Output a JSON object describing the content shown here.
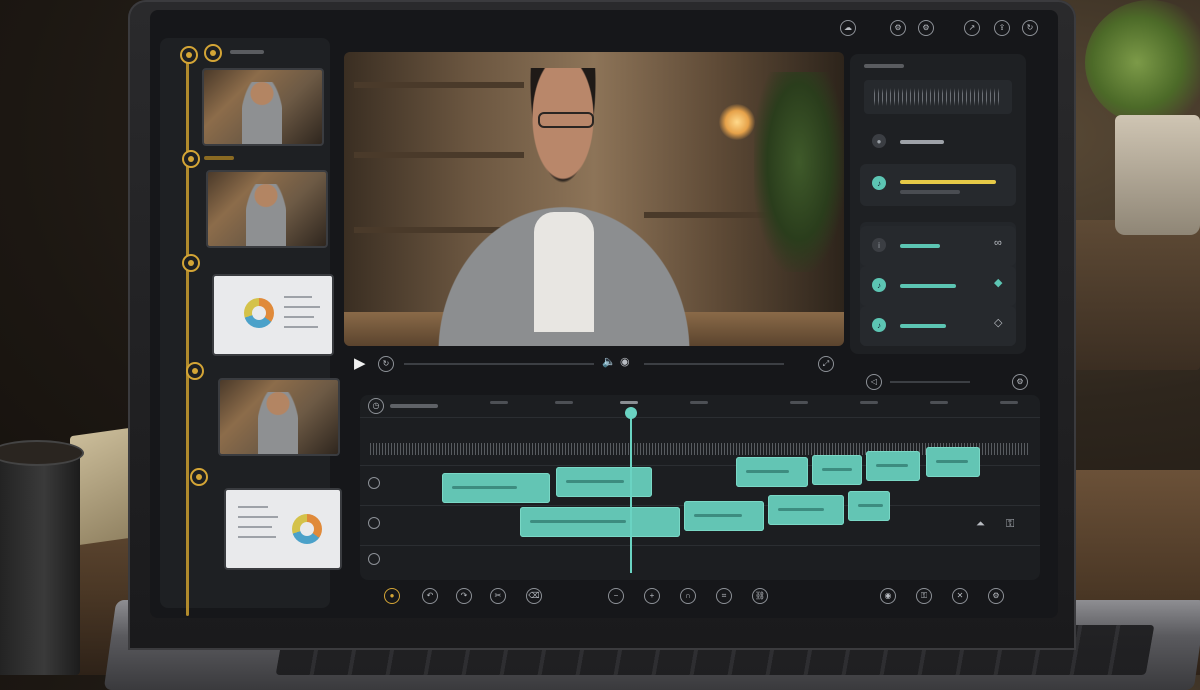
{
  "scene": {
    "accent_color": "#d4a536",
    "clip_color": "#63c5b4",
    "highlight_color": "#e6c947"
  },
  "toolbar": {
    "top_icons": [
      "cloud-sync-icon",
      "settings-icon",
      "settings-icon",
      "share-icon",
      "export-icon",
      "refresh-icon"
    ]
  },
  "left_panel": {
    "thumbnails": [
      {
        "type": "video"
      },
      {
        "type": "video"
      },
      {
        "type": "document"
      },
      {
        "type": "video"
      },
      {
        "type": "document"
      }
    ]
  },
  "player": {
    "controls": [
      "play-icon",
      "loop-icon",
      "volume-icon",
      "camera-icon",
      "fullscreen-icon"
    ]
  },
  "right_panel": {
    "rows": [
      {
        "icon": "mic-icon",
        "active": false
      },
      {
        "icon": "audio-icon",
        "active": true
      },
      {
        "icon": "info-icon",
        "active": false
      },
      {
        "icon": "audio-icon",
        "active": true
      },
      {
        "icon": "audio-icon",
        "active": true
      }
    ]
  },
  "timeline": {
    "tracks": 3,
    "playhead_position": 0.39
  },
  "bottom_bar": {
    "icons": [
      "record-icon",
      "undo-icon",
      "redo-icon",
      "split-icon",
      "cut-icon",
      "zoom-out-icon",
      "zoom-in-icon",
      "magnet-icon",
      "crop-icon",
      "link-icon",
      "eye-icon",
      "lock-icon",
      "delete-icon",
      "settings-icon"
    ]
  }
}
